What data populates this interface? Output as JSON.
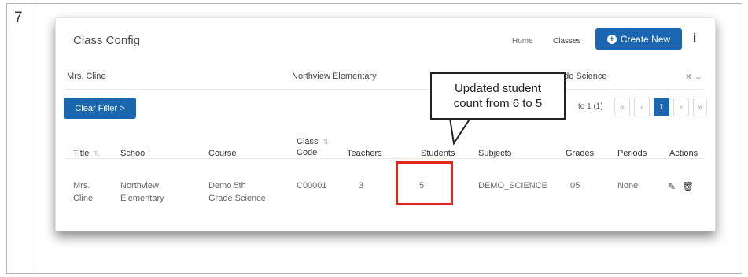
{
  "step": {
    "number": "7"
  },
  "app": {
    "title": "Class Config"
  },
  "nav": {
    "home": "Home",
    "classes": "Classes",
    "create_new": "Create New",
    "info": "i"
  },
  "filters": {
    "teacher": "Mrs. Cline",
    "school": "Northview Elementary",
    "course": "ade Science",
    "clear_label": "Clear Filter >"
  },
  "pagination": {
    "info": "to 1 (1)",
    "first": "«",
    "prev": "‹",
    "current": "1",
    "next": "›",
    "last": "»"
  },
  "table": {
    "columns": {
      "title": "Title",
      "school": "School",
      "course": "Course",
      "class_code_1": "Class",
      "class_code_2": "Code",
      "teachers": "Teachers",
      "students": "Students",
      "subjects": "Subjects",
      "grades": "Grades",
      "periods": "Periods",
      "actions": "Actions"
    },
    "row": {
      "title_1": "Mrs.",
      "title_2": "Cline",
      "school_1": "Northview",
      "school_2": "Elementary",
      "course_1": "Demo 5th",
      "course_2": "Grade Science",
      "class_code": "C00001",
      "teachers": "3",
      "students": "5",
      "subjects": "DEMO_SCIENCE",
      "grades": "05",
      "periods": "None"
    }
  },
  "annotation": {
    "line1": "Updated student",
    "line2": "count from 6 to 5",
    "highlight_color": "#e0261a"
  },
  "colors": {
    "primary": "#1b66b0"
  }
}
